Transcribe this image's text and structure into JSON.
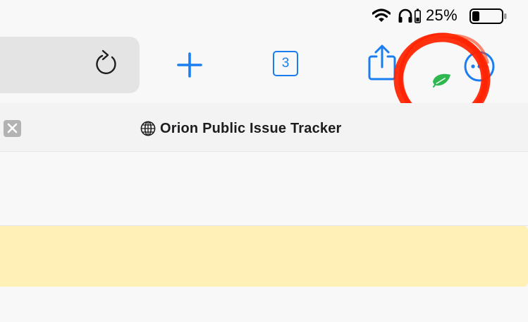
{
  "status_bar": {
    "battery_percent": "25%",
    "battery_level": 0.25,
    "icons": [
      "wifi-icon",
      "headphones-icon",
      "battery-icon"
    ]
  },
  "toolbar": {
    "icons": [
      "reload-icon",
      "plus-icon",
      "tabs-icon",
      "share-icon",
      "leaf-icon",
      "more-icon"
    ],
    "tab_count": "3",
    "accent_color": "#1a7ef0",
    "leaf_color": "#2fb84f",
    "annotation_color": "#ff2200"
  },
  "tab": {
    "title": "Orion Public Issue Tracker",
    "favicon": "globe-icon",
    "close_icon": "close-icon"
  },
  "page": {
    "banner_color": "#fff1b5"
  }
}
